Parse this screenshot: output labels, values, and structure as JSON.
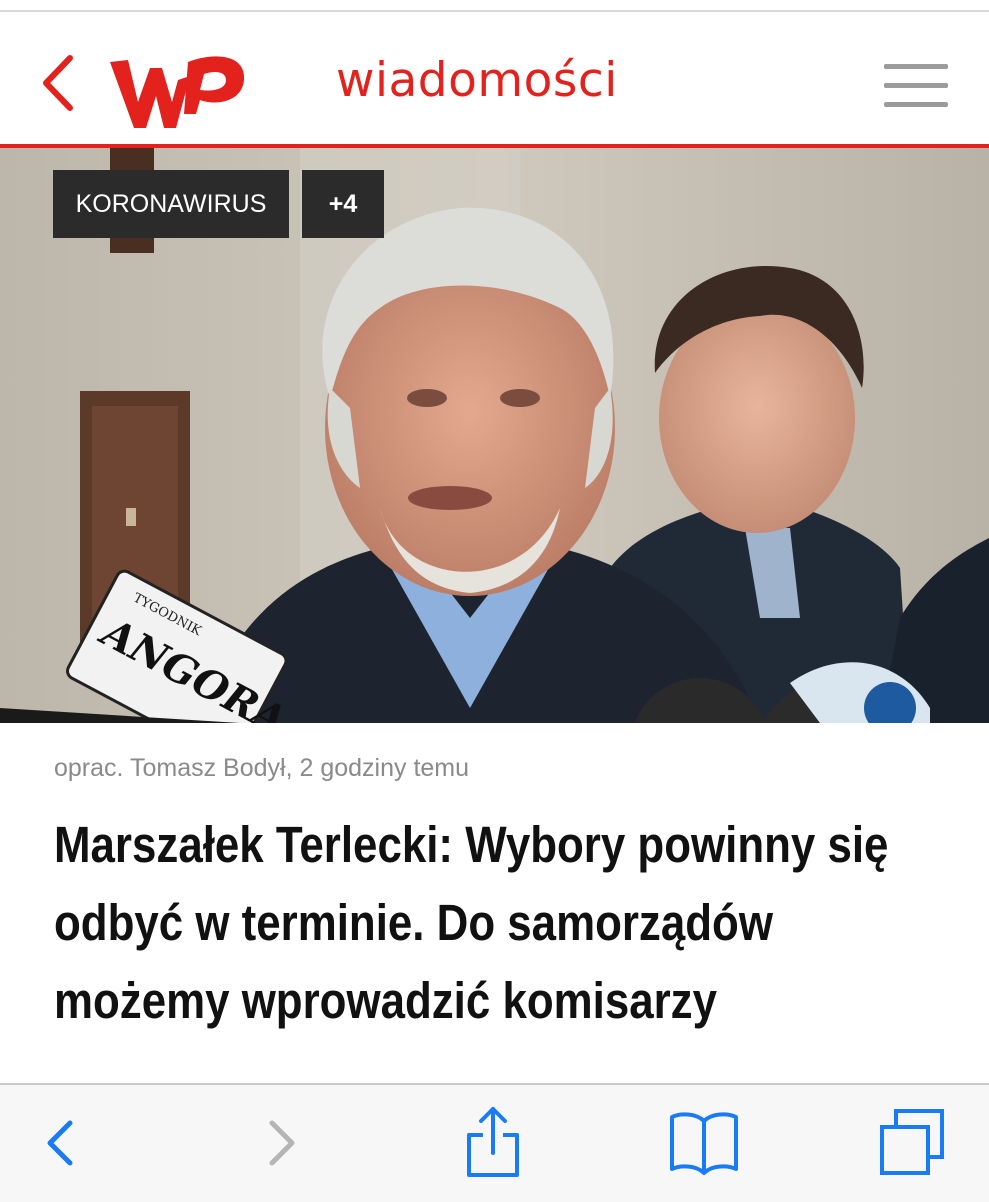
{
  "header": {
    "logo_text": "WP",
    "section_title": "wiadomości",
    "back_icon": "chevron-left-icon",
    "menu_icon": "hamburger-menu-icon",
    "accent_color": "#e3211d"
  },
  "hero": {
    "tags": [
      {
        "label": "KORONAWIRUS"
      },
      {
        "label": "+4"
      }
    ],
    "microphone_brand": "ANGORA",
    "microphone_brand_small": "TYGODNIK"
  },
  "article": {
    "byline": "oprac. Tomasz Bodył, 2 godziny temu",
    "headline": "Marszałek Terlecki: Wybory powinny się odbyć w terminie. Do samorządów możemy wprowadzić komisarzy"
  },
  "browser_toolbar": {
    "back_icon": "chevron-left-icon",
    "forward_icon": "chevron-right-icon",
    "share_icon": "share-icon",
    "bookmarks_icon": "book-icon",
    "tabs_icon": "tabs-icon",
    "accent_color": "#1a7cf5"
  }
}
